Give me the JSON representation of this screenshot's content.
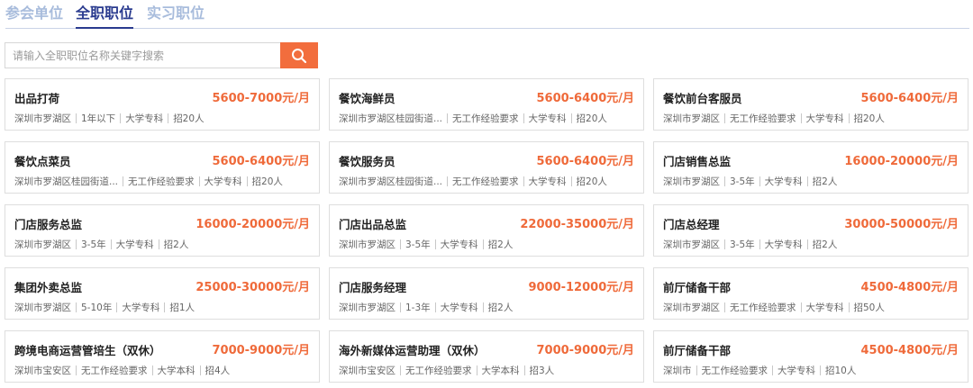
{
  "tabs": [
    {
      "label": "参会单位",
      "active": false
    },
    {
      "label": "全职职位",
      "active": true
    },
    {
      "label": "实习职位",
      "active": false
    }
  ],
  "search": {
    "placeholder": "请输入全职职位名称关键字搜索",
    "value": ""
  },
  "colors": {
    "accent": "#f26d3d",
    "salary": "#ef6a3a",
    "tab_active": "#2a3b8f",
    "tab_inactive": "#a8bcdc"
  },
  "icons": {
    "search_button": "search-icon"
  },
  "jobs": [
    {
      "title": "出品打荷",
      "salary": "5600-7000元/月",
      "location": "深圳市罗湖区",
      "experience": "1年以下",
      "education": "大学专科",
      "count": "招20人"
    },
    {
      "title": "餐饮海鲜员",
      "salary": "5600-6400元/月",
      "location": "深圳市罗湖区桂园街道...",
      "experience": "无工作经验要求",
      "education": "大学专科",
      "count": "招20人"
    },
    {
      "title": "餐饮前台客服员",
      "salary": "5600-6400元/月",
      "location": "深圳市罗湖区",
      "experience": "无工作经验要求",
      "education": "大学专科",
      "count": "招20人"
    },
    {
      "title": "餐饮点菜员",
      "salary": "5600-6400元/月",
      "location": "深圳市罗湖区桂园街道...",
      "experience": "无工作经验要求",
      "education": "大学专科",
      "count": "招20人"
    },
    {
      "title": "餐饮服务员",
      "salary": "5600-6400元/月",
      "location": "深圳市罗湖区桂园街道...",
      "experience": "无工作经验要求",
      "education": "大学专科",
      "count": "招20人"
    },
    {
      "title": "门店销售总监",
      "salary": "16000-20000元/月",
      "location": "深圳市罗湖区",
      "experience": "3-5年",
      "education": "大学专科",
      "count": "招2人"
    },
    {
      "title": "门店服务总监",
      "salary": "16000-20000元/月",
      "location": "深圳市罗湖区",
      "experience": "3-5年",
      "education": "大学专科",
      "count": "招2人"
    },
    {
      "title": "门店出品总监",
      "salary": "22000-35000元/月",
      "location": "深圳市罗湖区",
      "experience": "3-5年",
      "education": "大学专科",
      "count": "招2人"
    },
    {
      "title": "门店总经理",
      "salary": "30000-50000元/月",
      "location": "深圳市罗湖区",
      "experience": "3-5年",
      "education": "大学专科",
      "count": "招2人"
    },
    {
      "title": "集团外卖总监",
      "salary": "25000-30000元/月",
      "location": "深圳市罗湖区",
      "experience": "5-10年",
      "education": "大学专科",
      "count": "招1人"
    },
    {
      "title": "门店服务经理",
      "salary": "9000-12000元/月",
      "location": "深圳市罗湖区",
      "experience": "1-3年",
      "education": "大学专科",
      "count": "招2人"
    },
    {
      "title": "前厅储备干部",
      "salary": "4500-4800元/月",
      "location": "深圳市罗湖区",
      "experience": "无工作经验要求",
      "education": "大学专科",
      "count": "招50人"
    },
    {
      "title": "跨境电商运营管培生（双休）",
      "salary": "7000-9000元/月",
      "location": "深圳市宝安区",
      "experience": "无工作经验要求",
      "education": "大学本科",
      "count": "招4人"
    },
    {
      "title": "海外新媒体运营助理（双休）",
      "salary": "7000-9000元/月",
      "location": "深圳市宝安区",
      "experience": "无工作经验要求",
      "education": "大学本科",
      "count": "招3人"
    },
    {
      "title": "前厅储备干部",
      "salary": "4500-4800元/月",
      "location": "深圳市",
      "experience": "无工作经验要求",
      "education": "大学专科",
      "count": "招10人"
    }
  ]
}
